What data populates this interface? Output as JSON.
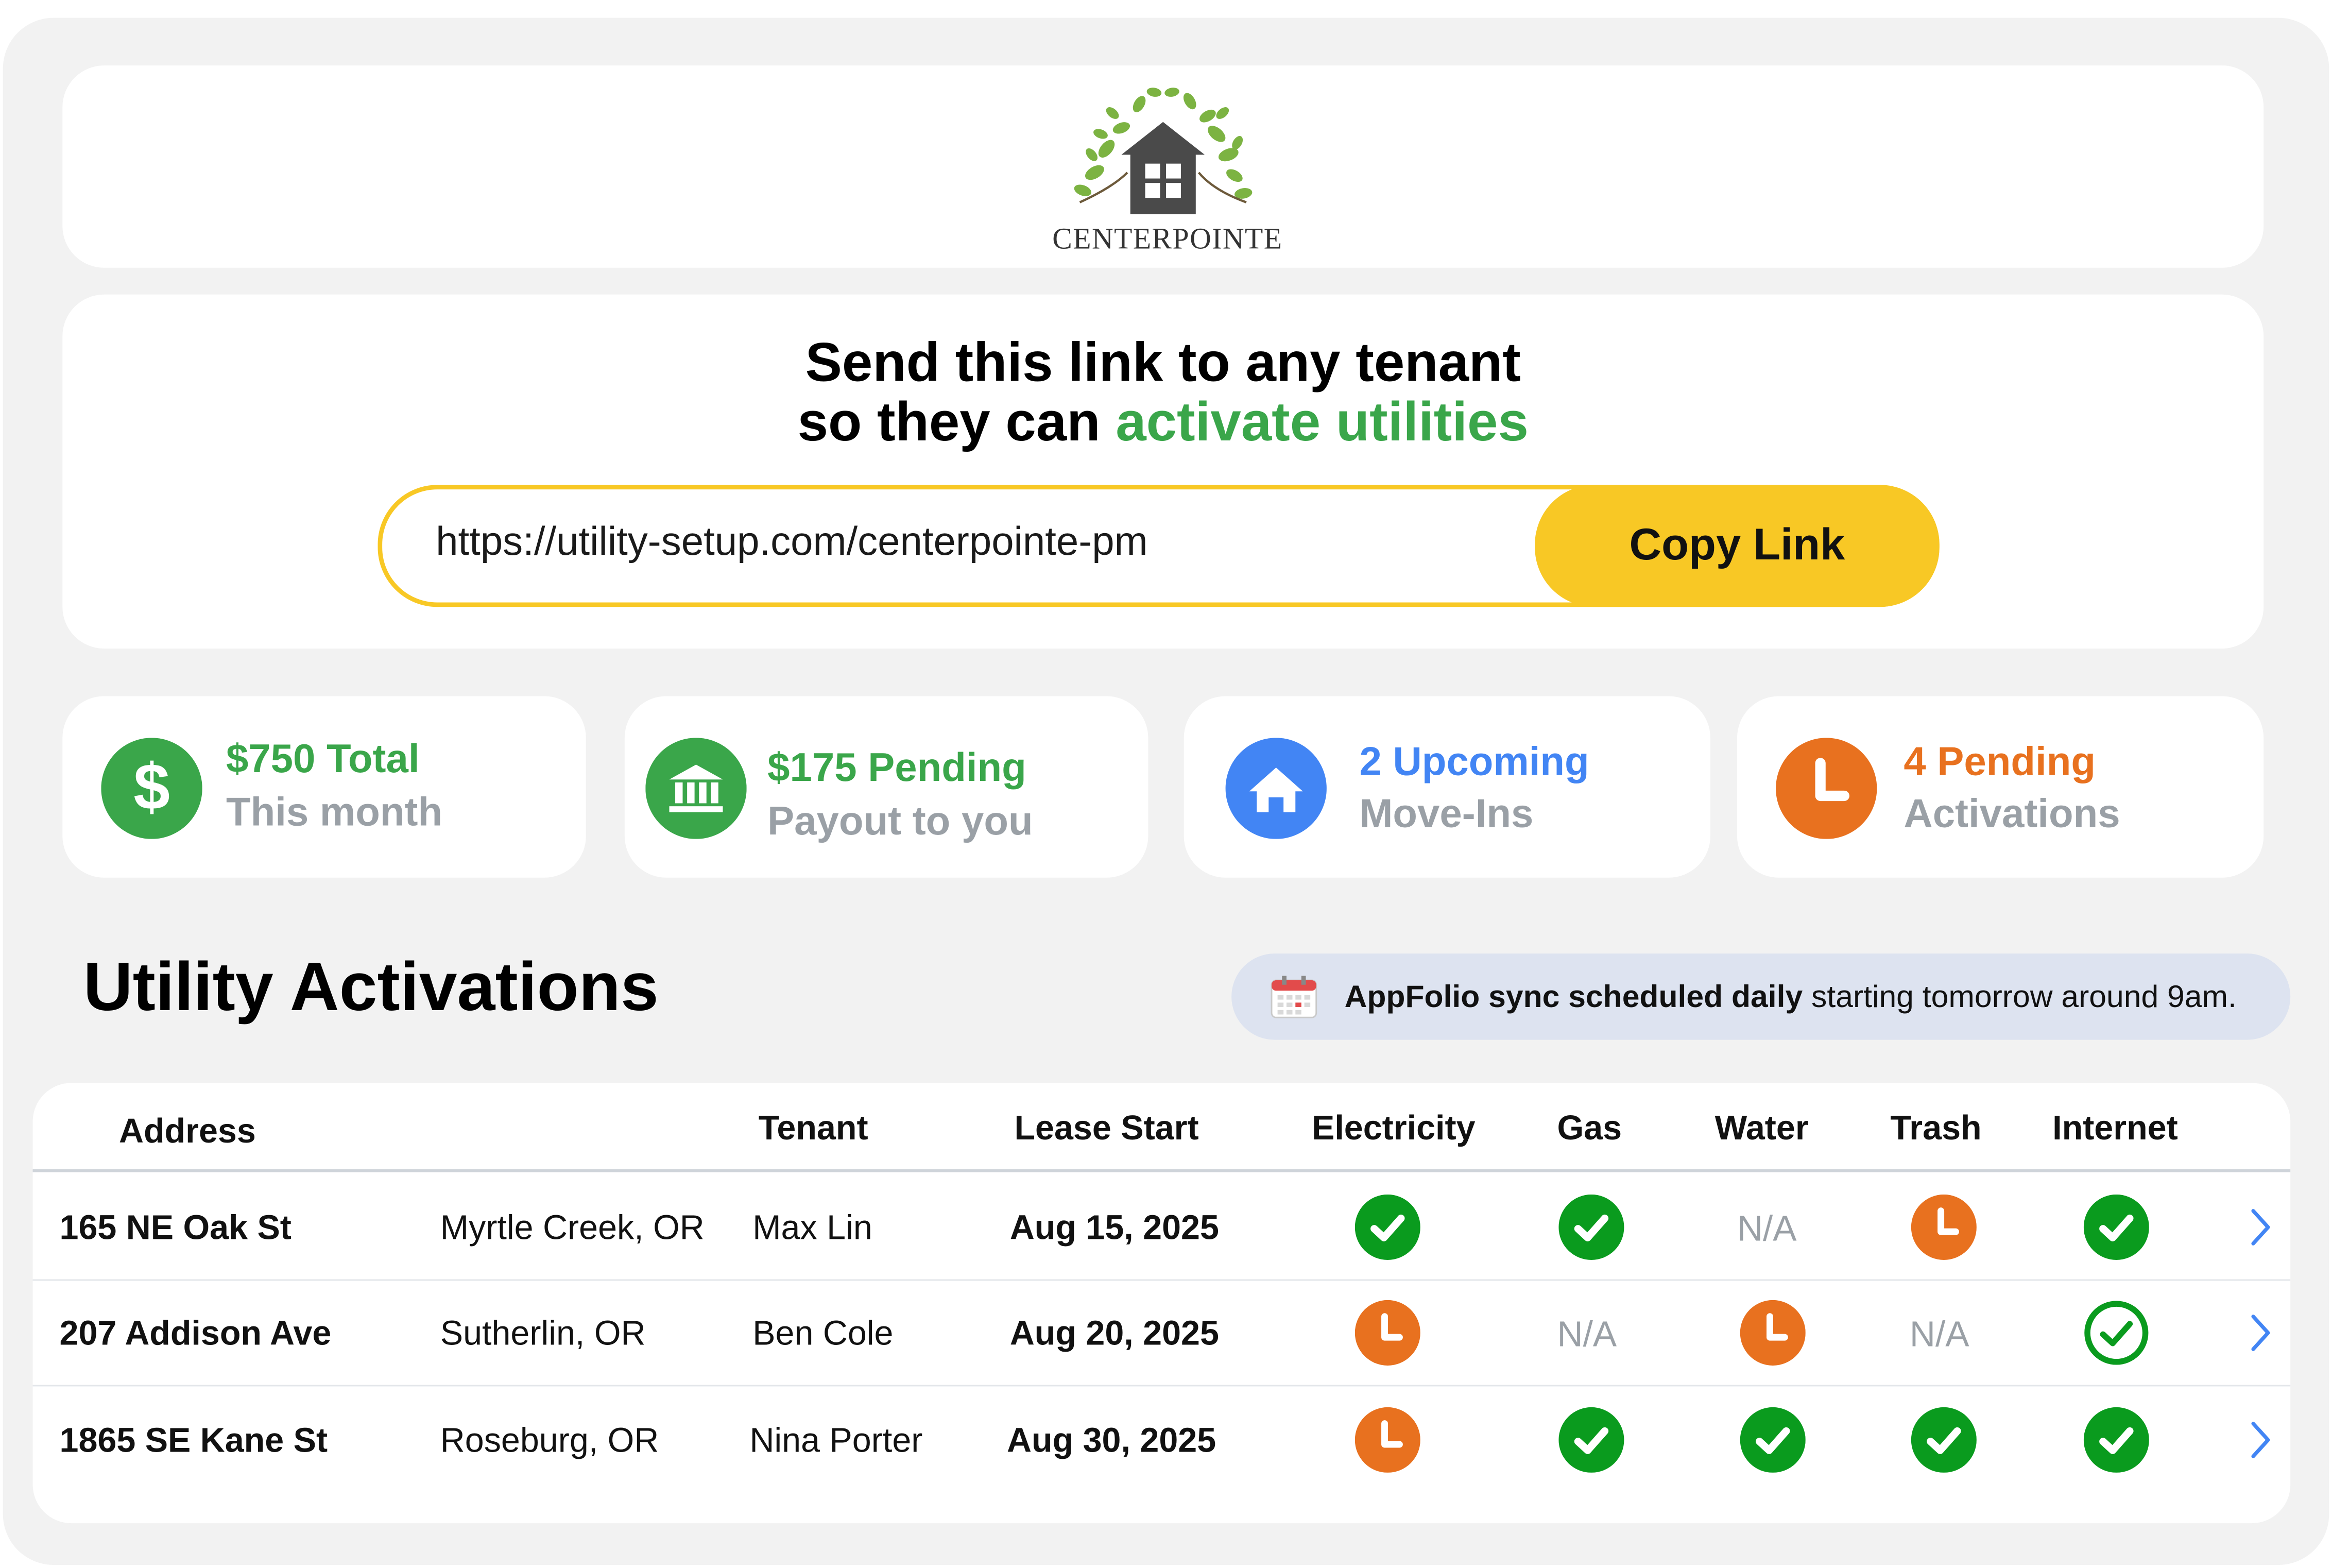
{
  "brand": {
    "name": "CENTERPOINTE"
  },
  "link_card": {
    "headline_line1": "Send this link to any tenant",
    "headline_line2_prefix": "so they can ",
    "headline_line2_highlight": "activate utilities",
    "url": "https://utility-setup.com/centerpointe-pm",
    "copy_label": "Copy Link"
  },
  "stats": [
    {
      "title": "$750 Total",
      "subtitle": "This month",
      "icon": "dollar-icon",
      "color": "#3aa64a"
    },
    {
      "title": "$175 Pending",
      "subtitle": "Payout to you",
      "icon": "bank-icon",
      "color": "#3aa64a"
    },
    {
      "title": "2 Upcoming",
      "subtitle": "Move-Ins",
      "icon": "house-icon",
      "color": "#4285f4"
    },
    {
      "title": "4 Pending",
      "subtitle": "Activations",
      "icon": "clock-icon",
      "color": "#e8711f"
    }
  ],
  "section": {
    "title": "Utility Activations",
    "sync_bold": "AppFolio sync scheduled daily",
    "sync_rest": " starting tomorrow around 9am."
  },
  "table": {
    "headers": [
      "Address",
      "Tenant",
      "Lease Start",
      "Electricity",
      "Gas",
      "Water",
      "Trash",
      "Internet"
    ],
    "na_label": "N/A",
    "rows": [
      {
        "address": "165 NE Oak St",
        "city": "Myrtle Creek, OR",
        "tenant": "Max Lin",
        "lease_start": "Aug 15, 2025",
        "statuses": [
          "done",
          "done",
          "na",
          "pending",
          "done"
        ]
      },
      {
        "address": "207 Addison Ave",
        "city": "Sutherlin, OR",
        "tenant": "Ben Cole",
        "lease_start": "Aug 20, 2025",
        "statuses": [
          "pending",
          "na",
          "pending",
          "na",
          "done-outline"
        ]
      },
      {
        "address": "1865 SE Kane St",
        "city": "Roseburg, OR",
        "tenant": "Nina Porter",
        "lease_start": "Aug 30, 2025",
        "statuses": [
          "pending",
          "done",
          "done",
          "done",
          "done"
        ]
      }
    ]
  },
  "colors": {
    "accent_yellow": "#f8c825",
    "done_green": "#0a9b1e",
    "pending_orange": "#e8711f",
    "link_blue": "#4285f4",
    "banner_bg": "#dde3f0"
  }
}
